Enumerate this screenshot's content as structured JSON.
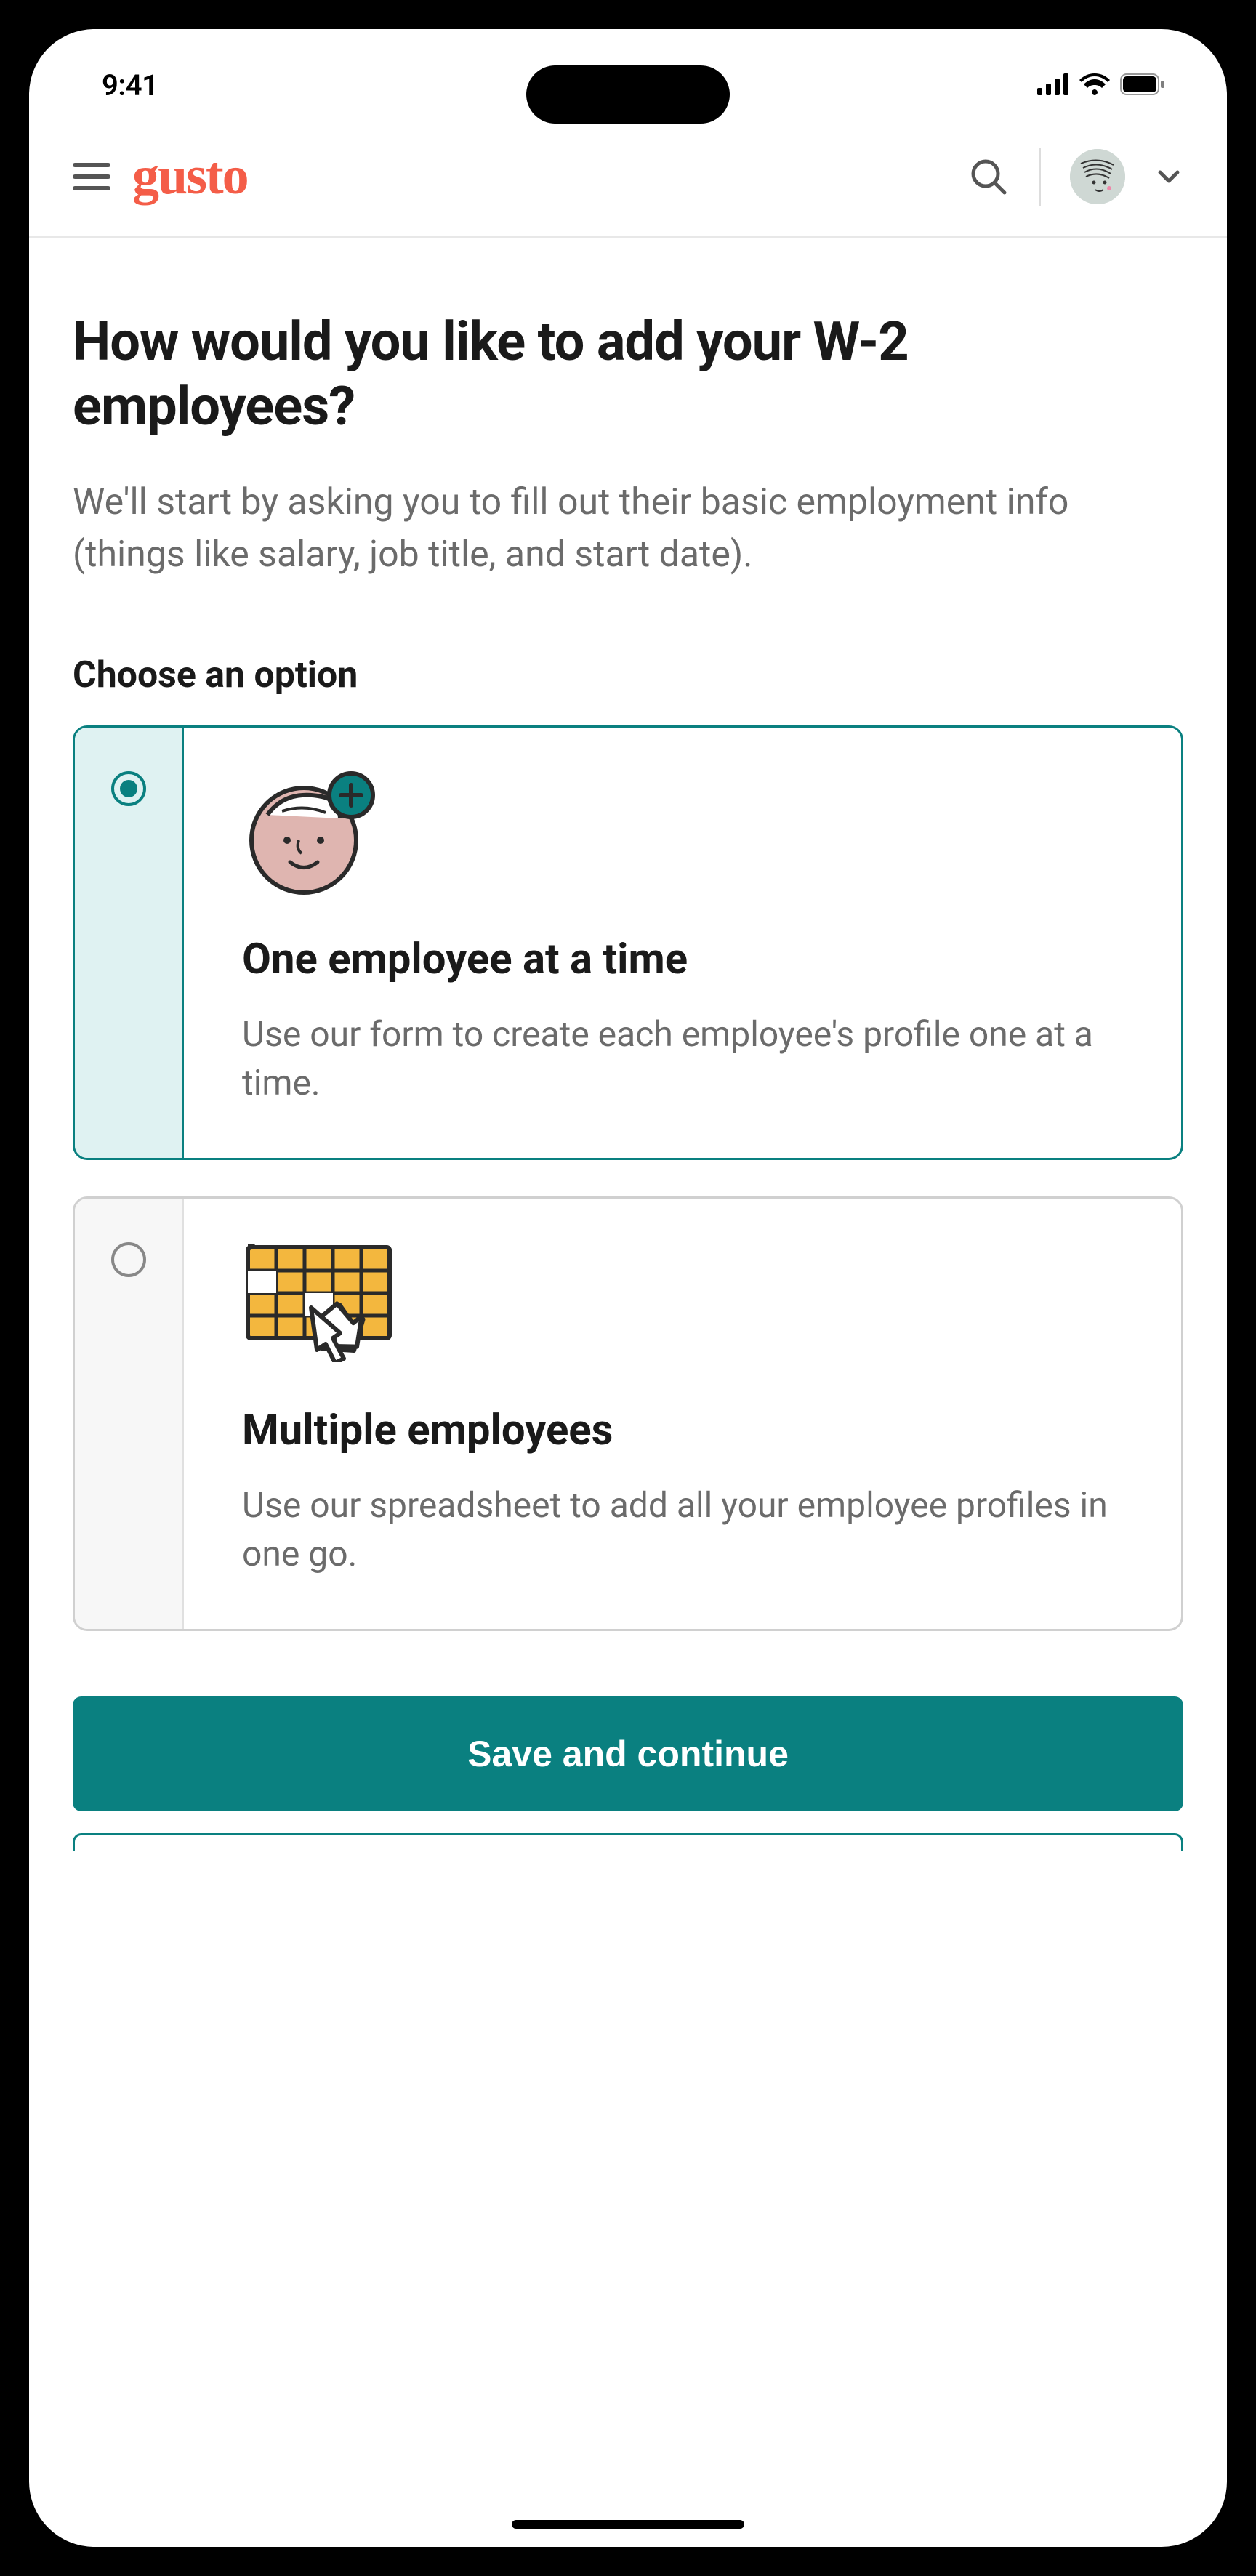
{
  "status": {
    "time": "9:41"
  },
  "header": {
    "logo": "gusto"
  },
  "page": {
    "title": "How would you like to add your W-2 employees?",
    "description": "We'll start by asking you to fill out their basic employment info (things like salary, job title, and start date).",
    "section_label": "Choose an option"
  },
  "options": [
    {
      "title": "One employee at a time",
      "description": "Use our form to create each employee's profile one at a time.",
      "selected": true,
      "icon": "person-add"
    },
    {
      "title": "Multiple employees",
      "description": "Use our spreadsheet to add all your employee profiles in one go.",
      "selected": false,
      "icon": "spreadsheet"
    }
  ],
  "actions": {
    "primary": "Save and continue"
  }
}
